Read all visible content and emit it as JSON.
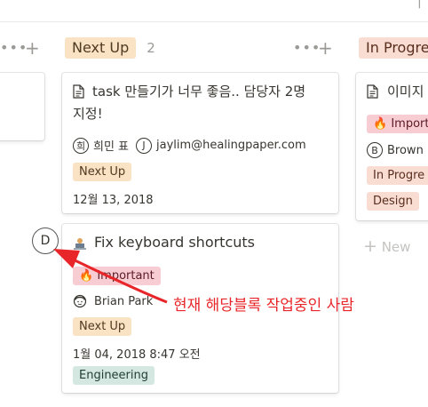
{
  "columns": [
    {
      "label": "Next Up",
      "count": "2"
    },
    {
      "label": "In Progre"
    }
  ],
  "header_icons": {
    "more": "•••",
    "add": "+"
  },
  "cards": {
    "task": {
      "title_line1": "task 만들기가 너무 좋음.. 담당자 2명",
      "title_line2": "지정!",
      "person1_initial": "희",
      "person1_name": "희민 표",
      "person2_initial": "J",
      "person2_name": "jaylim@healingpaper.com",
      "status": "Next Up",
      "date": "12월 13, 2018"
    },
    "keyboard": {
      "title": "Fix keyboard shortcuts",
      "priority": "🔥 Important",
      "assignee": "Brian Park",
      "status": "Next Up",
      "date": "1월 04, 2018 8:47 오전",
      "team": "Engineering"
    },
    "right": {
      "title": "이미지",
      "priority": "🔥 Import",
      "person_initial": "B",
      "person_name": "Brown",
      "status": "In Progre",
      "team": "Design"
    }
  },
  "new_label": "New",
  "presence_initial": "D",
  "annotation": "현재 해당블록 작업중인 사람",
  "colors": {
    "accent_red": "#e8262a",
    "next_up": "#fae3c4",
    "in_progress": "#f9ddd2",
    "important": "#f7cdd3",
    "engineering": "#d4e7e1"
  }
}
